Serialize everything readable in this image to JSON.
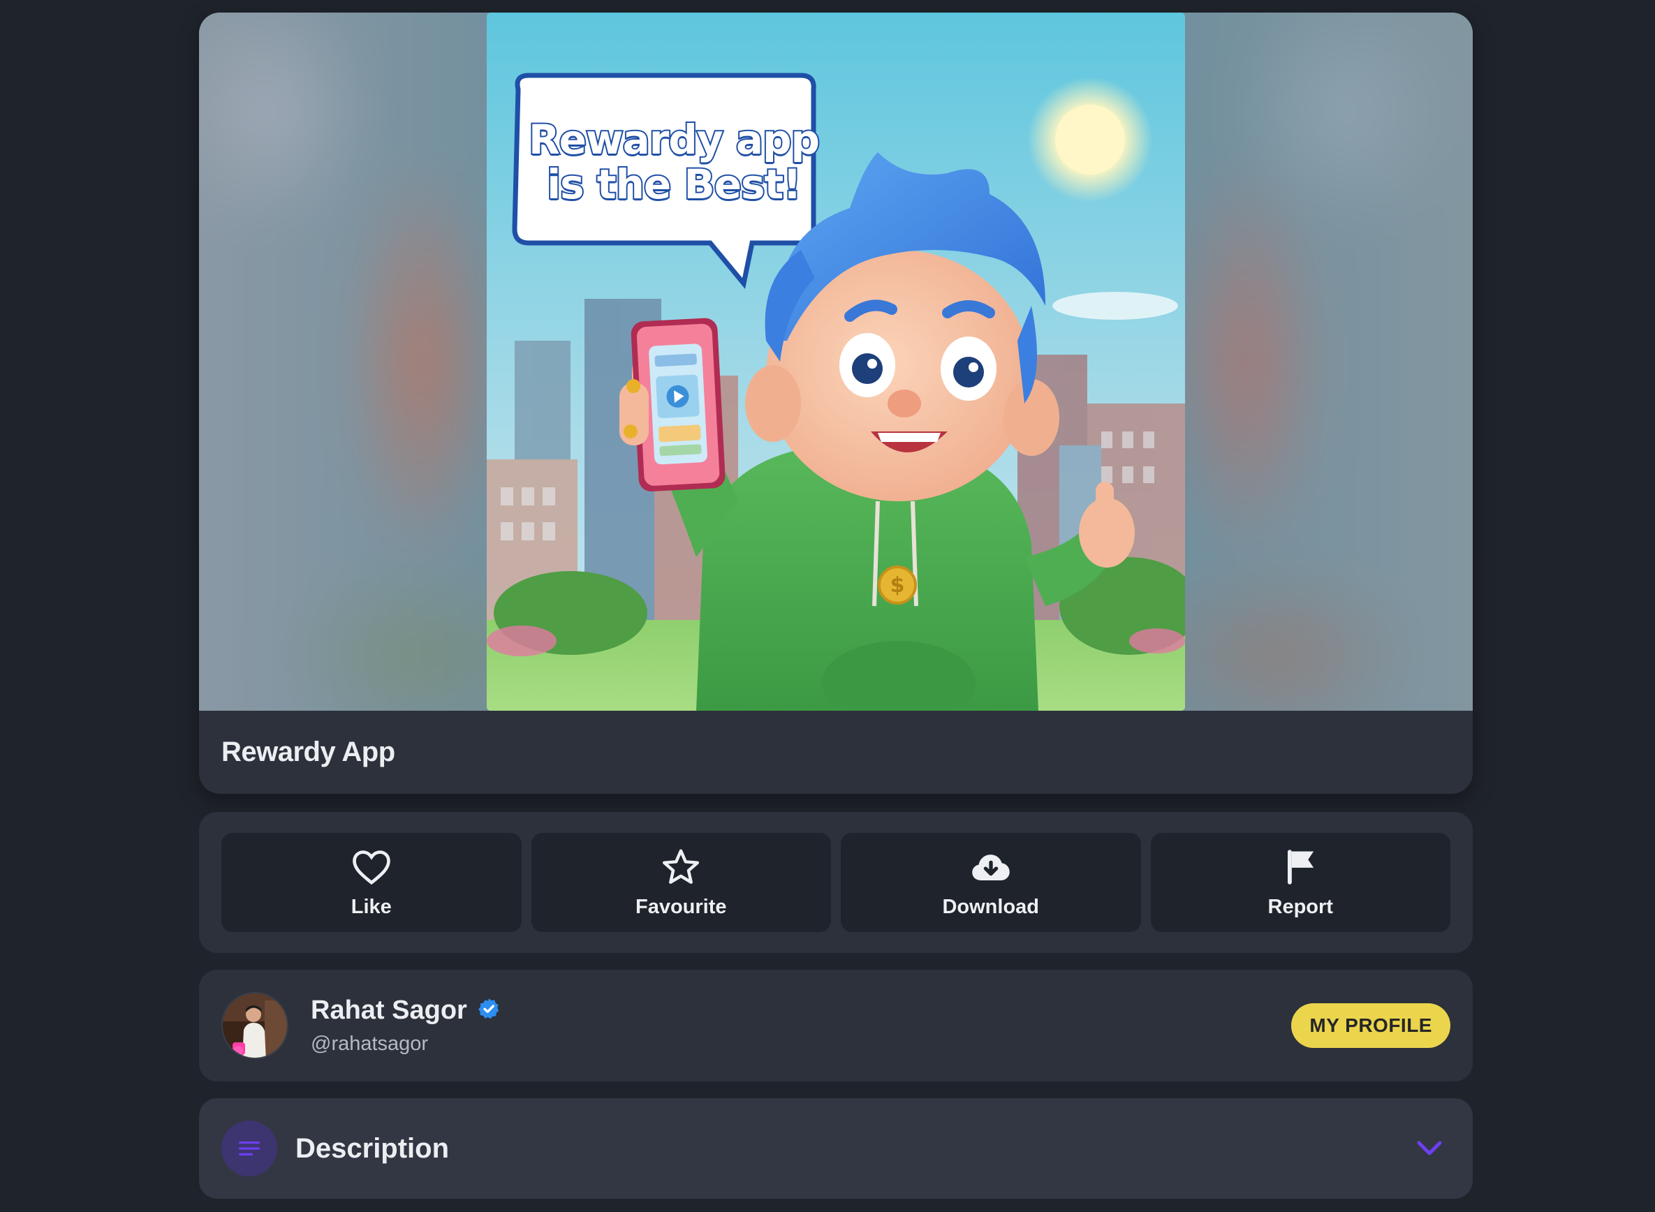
{
  "post": {
    "title": "Rewardy App",
    "image_caption": "Rewardy app is the Best!"
  },
  "actions": [
    {
      "label": "Like",
      "icon": "heart-icon"
    },
    {
      "label": "Favourite",
      "icon": "star-icon"
    },
    {
      "label": "Download",
      "icon": "cloud-download-icon"
    },
    {
      "label": "Report",
      "icon": "flag-icon"
    }
  ],
  "author": {
    "name": "Rahat Sagor",
    "handle": "@rahatsagor",
    "verified": true,
    "profile_button": "MY PROFILE"
  },
  "description": {
    "title": "Description",
    "expanded": false
  },
  "colors": {
    "background": "#1f232b",
    "card": "#2c313b",
    "accent_yellow": "#ebd54d",
    "accent_purple": "#6d3ff0",
    "verified_blue": "#2d8ef0"
  }
}
